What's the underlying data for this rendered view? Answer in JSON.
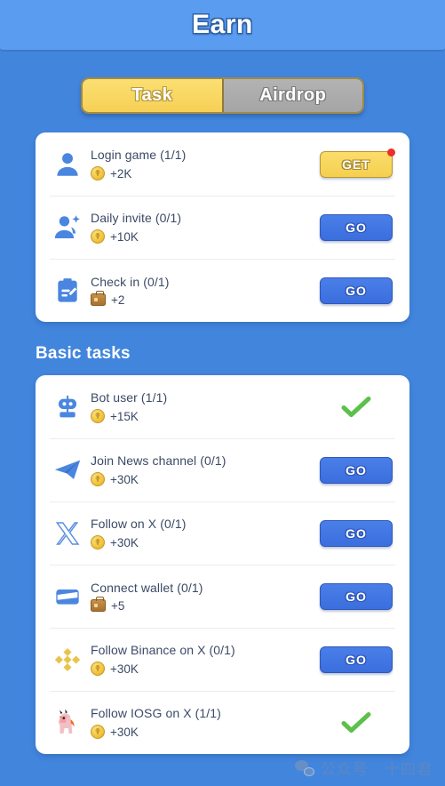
{
  "header": {
    "title": "Earn"
  },
  "tabs": [
    {
      "label": "Task",
      "state": "active"
    },
    {
      "label": "Airdrop",
      "state": "inactive"
    }
  ],
  "sections": [
    {
      "id": "daily",
      "heading": null,
      "rows": [
        {
          "icon": "person-icon",
          "title": "Login game (1/1)",
          "reward_icon": "coin-icon",
          "reward": "+2K",
          "action": "GET",
          "action_type": "get",
          "badge": true
        },
        {
          "icon": "person-add-icon",
          "title": "Daily invite (0/1)",
          "reward_icon": "coin-icon",
          "reward": "+10K",
          "action": "GO",
          "action_type": "go",
          "badge": false
        },
        {
          "icon": "clipboard-check-icon",
          "title": "Check in (0/1)",
          "reward_icon": "briefcase-icon",
          "reward": "+2",
          "action": "GO",
          "action_type": "go",
          "badge": false
        }
      ]
    },
    {
      "id": "basic",
      "heading": "Basic tasks",
      "rows": [
        {
          "icon": "robot-icon",
          "title": "Bot user (1/1)",
          "reward_icon": "coin-icon",
          "reward": "+15K",
          "action": "",
          "action_type": "done",
          "badge": false
        },
        {
          "icon": "telegram-icon",
          "title": "Join News channel (0/1)",
          "reward_icon": "coin-icon",
          "reward": "+30K",
          "action": "GO",
          "action_type": "go",
          "badge": false
        },
        {
          "icon": "x-twitter-icon",
          "title": "Follow on X (0/1)",
          "reward_icon": "coin-icon",
          "reward": "+30K",
          "action": "GO",
          "action_type": "go",
          "badge": false
        },
        {
          "icon": "wallet-icon",
          "title": "Connect wallet (0/1)",
          "reward_icon": "briefcase-icon",
          "reward": "+5",
          "action": "GO",
          "action_type": "go",
          "badge": false
        },
        {
          "icon": "binance-icon",
          "title": "Follow Binance on X (0/1)",
          "reward_icon": "coin-icon",
          "reward": "+30K",
          "action": "GO",
          "action_type": "go",
          "badge": false
        },
        {
          "icon": "iosg-unicorn-icon",
          "title": "Follow IOSG on X (1/1)",
          "reward_icon": "coin-icon",
          "reward": "+30K",
          "action": "",
          "action_type": "done",
          "badge": false
        }
      ]
    }
  ],
  "watermark": {
    "icon": "wechat-icon",
    "text": "公众号 · 十四君"
  },
  "colors": {
    "background": "#4285dd",
    "header": "#5a9cf0",
    "card": "#ffffff",
    "accent_yellow": "#f6d055",
    "accent_blue": "#3b6ede",
    "done_green": "#5cc04a",
    "badge_red": "#ee2c2c",
    "text_dark": "#3b4a66"
  }
}
